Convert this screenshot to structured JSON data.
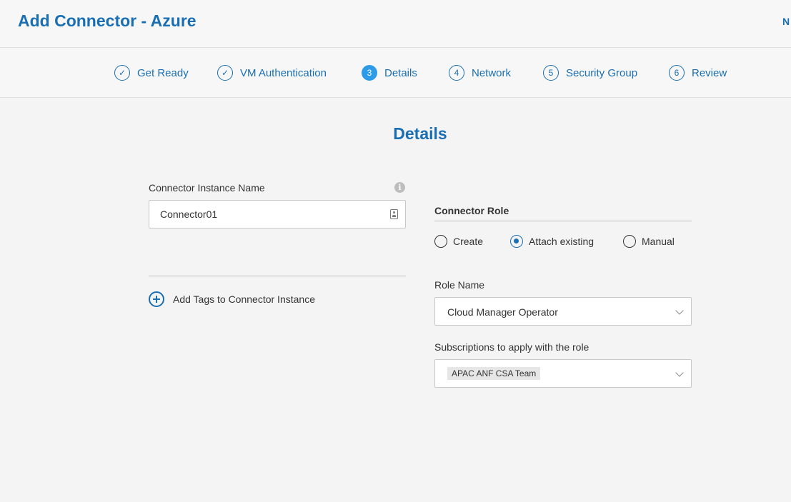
{
  "header": {
    "title": "Add Connector - Azure",
    "corner_text": "N"
  },
  "steps": [
    {
      "label": "Get Ready",
      "marker": "✓",
      "state": "done"
    },
    {
      "label": "VM Authentication",
      "marker": "✓",
      "state": "done"
    },
    {
      "label": "Details",
      "marker": "3",
      "state": "active"
    },
    {
      "label": "Network",
      "marker": "4",
      "state": "pending"
    },
    {
      "label": "Security Group",
      "marker": "5",
      "state": "pending"
    },
    {
      "label": "Review",
      "marker": "6",
      "state": "pending"
    }
  ],
  "page": {
    "heading": "Details"
  },
  "instance": {
    "label": "Connector Instance Name",
    "info_icon": "i",
    "value": "Connector01",
    "add_tags_label": "Add Tags to Connector Instance"
  },
  "role": {
    "section_title": "Connector Role",
    "options": [
      {
        "label": "Create",
        "selected": false
      },
      {
        "label": "Attach existing",
        "selected": true
      },
      {
        "label": "Manual",
        "selected": false
      }
    ],
    "role_name_label": "Role Name",
    "role_name_value": "Cloud Manager Operator",
    "subscriptions_label": "Subscriptions to apply with the role",
    "subscription_chip": "APAC ANF CSA Team"
  },
  "colors": {
    "accent": "#1a6fb3",
    "active_step": "#2d9be8",
    "background": "#f4f4f4"
  }
}
